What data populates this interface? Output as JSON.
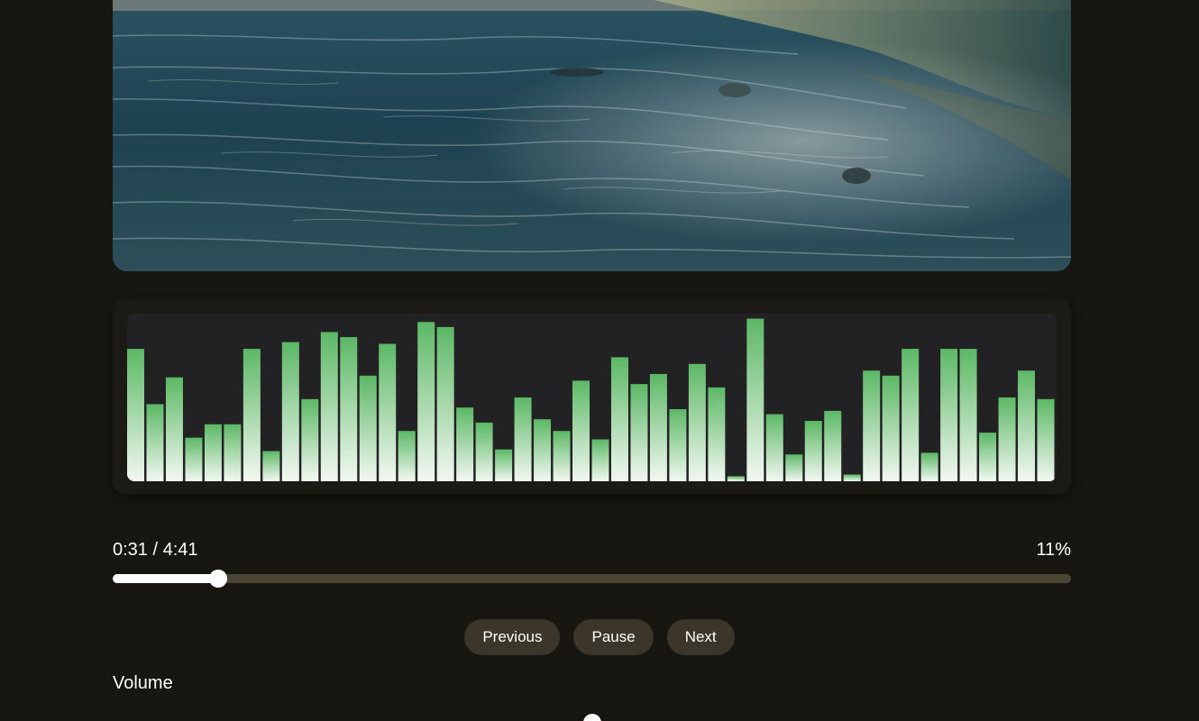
{
  "player": {
    "elapsed": "0:31",
    "total": "4:41",
    "time_display": "0:31 / 4:41",
    "percent_label": "11%",
    "progress_fraction": 0.11
  },
  "controls": {
    "previous_label": "Previous",
    "pause_label": "Pause",
    "next_label": "Next"
  },
  "volume": {
    "label": "Volume",
    "level_fraction": 0.5
  },
  "visualizer": {
    "bar_levels": [
      0.79,
      0.46,
      0.62,
      0.26,
      0.34,
      0.34,
      0.79,
      0.18,
      0.83,
      0.49,
      0.89,
      0.86,
      0.63,
      0.82,
      0.3,
      0.95,
      0.92,
      0.44,
      0.35,
      0.19,
      0.5,
      0.37,
      0.3,
      0.6,
      0.25,
      0.74,
      0.58,
      0.64,
      0.43,
      0.7,
      0.56,
      0.03,
      0.97,
      0.4,
      0.16,
      0.36,
      0.42,
      0.04,
      0.66,
      0.63,
      0.79,
      0.17,
      0.79,
      0.79,
      0.29,
      0.5,
      0.66,
      0.49
    ],
    "top_color": "#5cb865",
    "bottom_color": "#f2f8f1"
  },
  "colors": {
    "background": "#181610",
    "button_bg": "#3b3629",
    "track": "#4b4534",
    "fill": "#ffffff"
  }
}
